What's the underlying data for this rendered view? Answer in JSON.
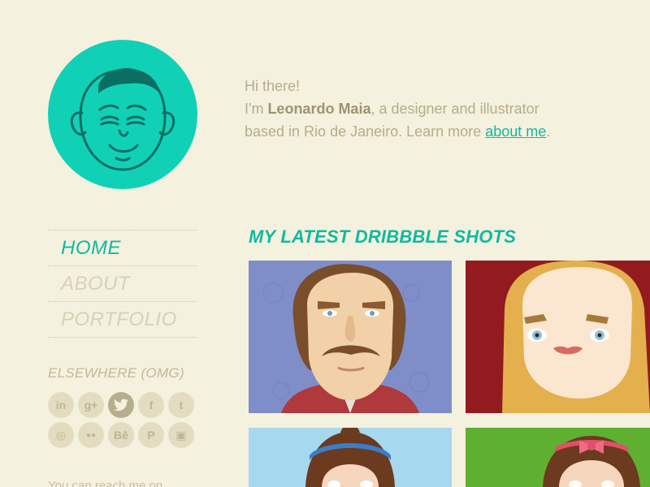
{
  "intro": {
    "greeting": "Hi there!",
    "im": "I'm ",
    "name": "Leonardo Maia",
    "desc1": ", a designer and illustrator",
    "desc2": "based in Rio de Janeiro. Learn more ",
    "link": "about me",
    "period": "."
  },
  "nav": {
    "items": [
      {
        "label": "HOME"
      },
      {
        "label": "ABOUT"
      },
      {
        "label": "PORTFOLIO"
      }
    ]
  },
  "elsewhere": "ELSEWHERE (OMG)",
  "social": [
    {
      "icon": "linkedin-icon",
      "glyph": "in"
    },
    {
      "icon": "googleplus-icon",
      "glyph": "g+"
    },
    {
      "icon": "twitter-icon",
      "glyph": "🐦"
    },
    {
      "icon": "facebook-icon",
      "glyph": "f"
    },
    {
      "icon": "tumblr-icon",
      "glyph": "t"
    },
    {
      "icon": "dribbble-icon",
      "glyph": "◎"
    },
    {
      "icon": "flickr-icon",
      "glyph": "●●"
    },
    {
      "icon": "behance-icon",
      "glyph": "Bē"
    },
    {
      "icon": "pinterest-icon",
      "glyph": "P"
    },
    {
      "icon": "instagram-icon",
      "glyph": "▣"
    }
  ],
  "reach": "You can reach me on",
  "shots_title": "MY LATEST DRIBBBLE SHOTS",
  "colors": {
    "accent": "#10b9a0",
    "avatar_bg": "#10d1b6",
    "background": "#f5f1df"
  }
}
